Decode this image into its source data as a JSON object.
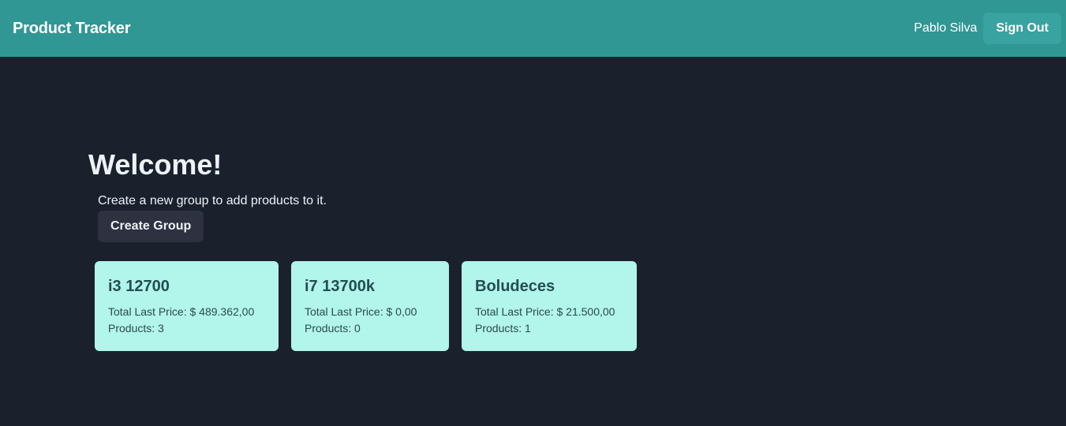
{
  "header": {
    "brand": "Product Tracker",
    "user_name": "Pablo Silva",
    "sign_out_label": "Sign Out"
  },
  "main": {
    "welcome": "Welcome!",
    "subtitle": "Create a new group to add products to it.",
    "create_group_label": "Create Group"
  },
  "groups": [
    {
      "name": "i3 12700",
      "total_label": "Total Last Price: $ 489.362,00",
      "products_label": "Products: 3"
    },
    {
      "name": "i7 13700k",
      "total_label": "Total Last Price: $ 0,00",
      "products_label": "Products: 0"
    },
    {
      "name": "Boludeces",
      "total_label": "Total Last Price: $ 21.500,00",
      "products_label": "Products: 1"
    }
  ],
  "colors": {
    "header_bg": "#319795",
    "page_bg": "#1b202d",
    "card_bg": "#b2f5ea",
    "card_text": "#234e52"
  }
}
